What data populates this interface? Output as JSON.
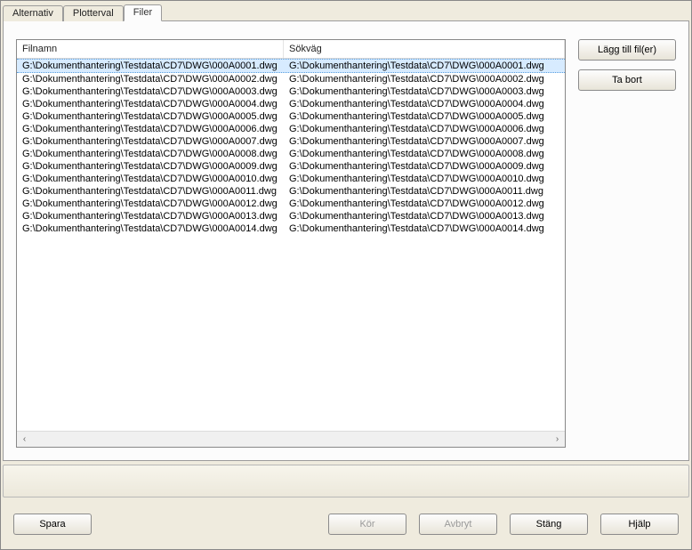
{
  "tabs": {
    "alternativ": "Alternativ",
    "plotterval": "Plotterval",
    "filer": "Filer"
  },
  "list": {
    "headers": {
      "filnamn": "Filnamn",
      "sokvag": "Sökväg"
    },
    "rows": [
      {
        "filnamn": "G:\\Dokumenthantering\\Testdata\\CD7\\DWG\\000A0001.dwg",
        "sokvag": "G:\\Dokumenthantering\\Testdata\\CD7\\DWG\\000A0001.dwg"
      },
      {
        "filnamn": "G:\\Dokumenthantering\\Testdata\\CD7\\DWG\\000A0002.dwg",
        "sokvag": "G:\\Dokumenthantering\\Testdata\\CD7\\DWG\\000A0002.dwg"
      },
      {
        "filnamn": "G:\\Dokumenthantering\\Testdata\\CD7\\DWG\\000A0003.dwg",
        "sokvag": "G:\\Dokumenthantering\\Testdata\\CD7\\DWG\\000A0003.dwg"
      },
      {
        "filnamn": "G:\\Dokumenthantering\\Testdata\\CD7\\DWG\\000A0004.dwg",
        "sokvag": "G:\\Dokumenthantering\\Testdata\\CD7\\DWG\\000A0004.dwg"
      },
      {
        "filnamn": "G:\\Dokumenthantering\\Testdata\\CD7\\DWG\\000A0005.dwg",
        "sokvag": "G:\\Dokumenthantering\\Testdata\\CD7\\DWG\\000A0005.dwg"
      },
      {
        "filnamn": "G:\\Dokumenthantering\\Testdata\\CD7\\DWG\\000A0006.dwg",
        "sokvag": "G:\\Dokumenthantering\\Testdata\\CD7\\DWG\\000A0006.dwg"
      },
      {
        "filnamn": "G:\\Dokumenthantering\\Testdata\\CD7\\DWG\\000A0007.dwg",
        "sokvag": "G:\\Dokumenthantering\\Testdata\\CD7\\DWG\\000A0007.dwg"
      },
      {
        "filnamn": "G:\\Dokumenthantering\\Testdata\\CD7\\DWG\\000A0008.dwg",
        "sokvag": "G:\\Dokumenthantering\\Testdata\\CD7\\DWG\\000A0008.dwg"
      },
      {
        "filnamn": "G:\\Dokumenthantering\\Testdata\\CD7\\DWG\\000A0009.dwg",
        "sokvag": "G:\\Dokumenthantering\\Testdata\\CD7\\DWG\\000A0009.dwg"
      },
      {
        "filnamn": "G:\\Dokumenthantering\\Testdata\\CD7\\DWG\\000A0010.dwg",
        "sokvag": "G:\\Dokumenthantering\\Testdata\\CD7\\DWG\\000A0010.dwg"
      },
      {
        "filnamn": "G:\\Dokumenthantering\\Testdata\\CD7\\DWG\\000A0011.dwg",
        "sokvag": "G:\\Dokumenthantering\\Testdata\\CD7\\DWG\\000A0011.dwg"
      },
      {
        "filnamn": "G:\\Dokumenthantering\\Testdata\\CD7\\DWG\\000A0012.dwg",
        "sokvag": "G:\\Dokumenthantering\\Testdata\\CD7\\DWG\\000A0012.dwg"
      },
      {
        "filnamn": "G:\\Dokumenthantering\\Testdata\\CD7\\DWG\\000A0013.dwg",
        "sokvag": "G:\\Dokumenthantering\\Testdata\\CD7\\DWG\\000A0013.dwg"
      },
      {
        "filnamn": "G:\\Dokumenthantering\\Testdata\\CD7\\DWG\\000A0014.dwg",
        "sokvag": "G:\\Dokumenthantering\\Testdata\\CD7\\DWG\\000A0014.dwg"
      }
    ],
    "selected_index": 0
  },
  "side": {
    "add_files": "Lägg till fil(er)",
    "remove": "Ta bort"
  },
  "bottom": {
    "save": "Spara",
    "run": "Kör",
    "cancel": "Avbryt",
    "close": "Stäng",
    "help": "Hjälp"
  },
  "scroll": {
    "left_glyph": "‹",
    "right_glyph": "›"
  }
}
